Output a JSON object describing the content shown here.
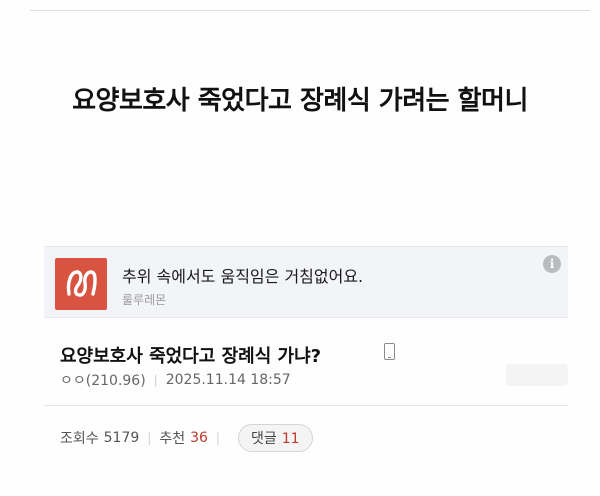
{
  "headline": "요양보호사 죽었다고 장례식 가려는 할머니",
  "ad": {
    "title": "추위 속에서도 움직임은 거침없어요.",
    "brand": "룰루레몬",
    "info_icon": "info-icon",
    "info_glyph": "i",
    "logo_color": "#d85440"
  },
  "post": {
    "title": "요양보호사 죽었다고 장례식 가냐?",
    "author": "ㅇㅇ(210.96)",
    "timestamp": "2025.11.14 18:57",
    "views_label": "조회수",
    "views": "5179",
    "recommend_label": "추천",
    "recommend": "36",
    "comments_label": "댓글",
    "comments": "11"
  },
  "colors": {
    "accent": "#c0392b",
    "ad_background": "#f3f4f8"
  }
}
